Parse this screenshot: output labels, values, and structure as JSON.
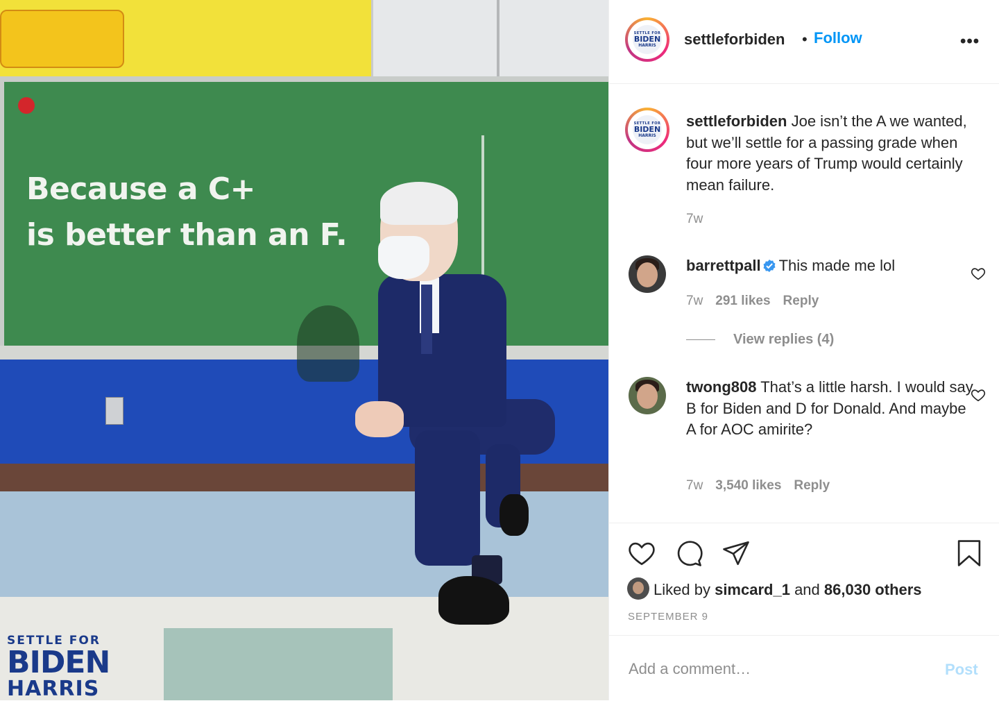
{
  "photo": {
    "board_line1": "Because a C+",
    "board_line2": "is better than an F.",
    "logo_line1": "SETTLE FOR",
    "logo_line2": "BIDEN",
    "logo_line3": "HARRIS"
  },
  "header": {
    "avatar_line1": "SETTLE FOR",
    "avatar_line2": "BIDEN",
    "avatar_line3": "HARRIS",
    "username": "settleforbiden",
    "separator": "•",
    "follow_label": "Follow",
    "more_label": "•••"
  },
  "caption": {
    "username": "settleforbiden",
    "text": "Joe isn’t the A we wanted, but we’ll settle for a passing grade when four more years of Trump would certainly mean failure.",
    "age": "7w"
  },
  "comments": [
    {
      "username": "barrettpall",
      "verified": true,
      "text": "This made me lol",
      "age": "7w",
      "likes": "291 likes",
      "reply_label": "Reply",
      "view_replies": "View replies (4)"
    },
    {
      "username": "twong808",
      "verified": false,
      "text": "That’s a little harsh. I would say B for Biden and D for Donald. And maybe A for AOC amirite?",
      "age": "7w",
      "likes": "3,540 likes",
      "reply_label": "Reply"
    }
  ],
  "actions": {
    "liked_prefix": "Liked by",
    "liked_user": "simcard_1",
    "liked_and": "and",
    "liked_others": "86,030 others",
    "date": "SEPTEMBER 9"
  },
  "comment_box": {
    "placeholder": "Add a comment…",
    "post_label": "Post"
  },
  "colors": {
    "link_blue": "#0095f6",
    "post_disabled": "#b2dffc",
    "muted": "#8e8e8e",
    "text": "#262626"
  }
}
